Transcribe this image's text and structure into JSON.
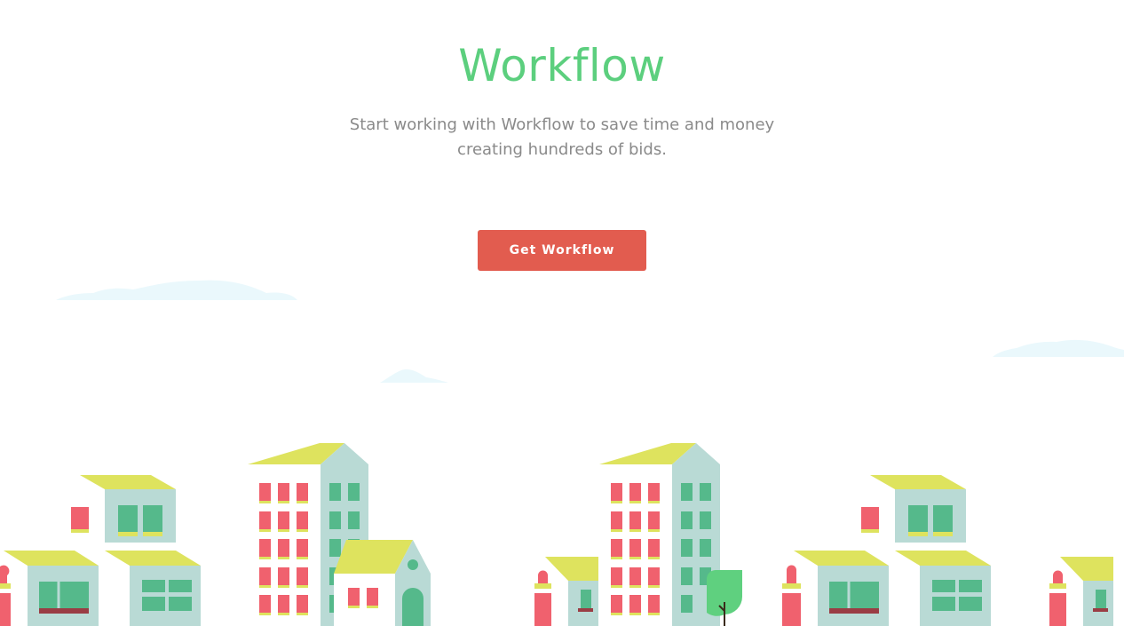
{
  "hero": {
    "title": "Workflow",
    "subtitle": "Start working with Workflow to save time and money creating hundreds of bids.",
    "cta_label": "Get Workflow"
  },
  "colors": {
    "title": "#5ccf7e",
    "subtitle": "#8a8a8a",
    "cta": "#e25c4f",
    "roof": "#dee35e",
    "wall": "#b9dad5",
    "window_green": "#55b98b",
    "window_red": "#f0616e",
    "tree": "#5fd07f",
    "cloud": "#eaf8fc"
  },
  "illustration": {
    "name": "city-skyline-illustration"
  }
}
